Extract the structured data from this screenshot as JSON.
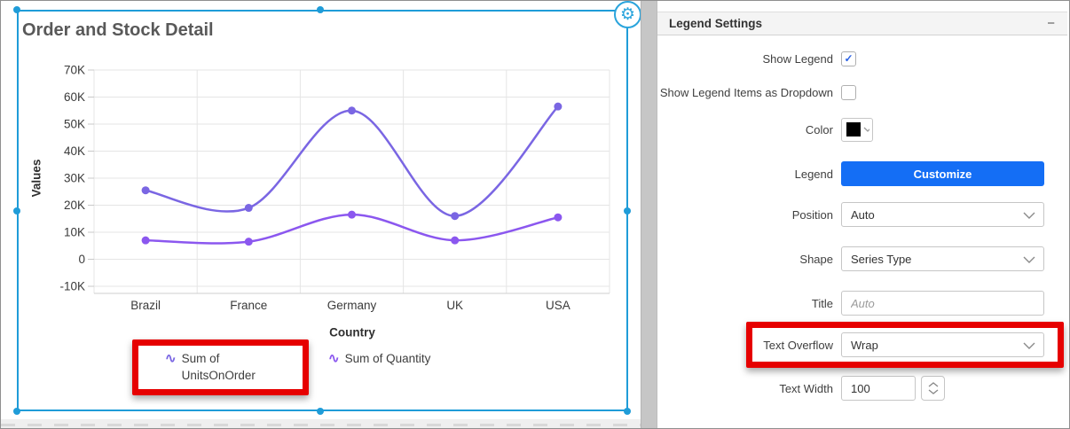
{
  "icons": {
    "gear": "⚙",
    "minus": "−",
    "check": "✓",
    "wave": "∿"
  },
  "colors": {
    "selection_blue": "#1f9cd8",
    "accent_blue": "#146ef5",
    "highlight_red": "#e60000",
    "series1": "#7a66e3",
    "series2": "#8b57ef",
    "check_blue": "#2a61e4"
  },
  "widget": {
    "title": "Order and Stock Detail"
  },
  "chart_data": {
    "type": "line",
    "title": "Order and Stock Detail",
    "xlabel": "Country",
    "ylabel": "Values",
    "categories": [
      "Brazil",
      "France",
      "Germany",
      "UK",
      "USA"
    ],
    "series": [
      {
        "name": "Sum of UnitsOnOrder",
        "color": "#7a66e3",
        "values": [
          25500,
          19000,
          55000,
          16000,
          56500
        ]
      },
      {
        "name": "Sum of Quantity",
        "color": "#8b57ef",
        "values": [
          7000,
          6500,
          16500,
          7000,
          15500
        ]
      }
    ],
    "ylim": [
      -10000,
      70000
    ],
    "ytick_step": 10000,
    "ytick_labels": [
      "70K",
      "60K",
      "50K",
      "40K",
      "30K",
      "20K",
      "10K",
      "0",
      "-10K"
    ],
    "grid": true,
    "smooth": true,
    "marker": "circle",
    "legend_position": "bottom"
  },
  "legend": {
    "items": [
      {
        "icon": "∿",
        "color": "#7a66e3",
        "label": "Sum of UnitsOnOrder"
      },
      {
        "icon": "∿",
        "color": "#8b57ef",
        "label": "Sum of Quantity"
      }
    ]
  },
  "panel": {
    "header": {
      "title": "Legend Settings",
      "collapse_icon": "−"
    },
    "show_legend": {
      "label": "Show Legend",
      "checked": true
    },
    "legend_items_dropdown": {
      "label": "Show Legend Items as Dropdown",
      "checked": false
    },
    "color": {
      "label": "Color",
      "value": "#000000"
    },
    "legend": {
      "label": "Legend",
      "button_label": "Customize"
    },
    "position": {
      "label": "Position",
      "value": "Auto"
    },
    "shape": {
      "label": "Shape",
      "value": "Series Type"
    },
    "title": {
      "label": "Title",
      "placeholder": "Auto"
    },
    "text_overflow": {
      "label": "Text Overflow",
      "value": "Wrap"
    },
    "text_width": {
      "label": "Text Width",
      "value": "100"
    }
  }
}
